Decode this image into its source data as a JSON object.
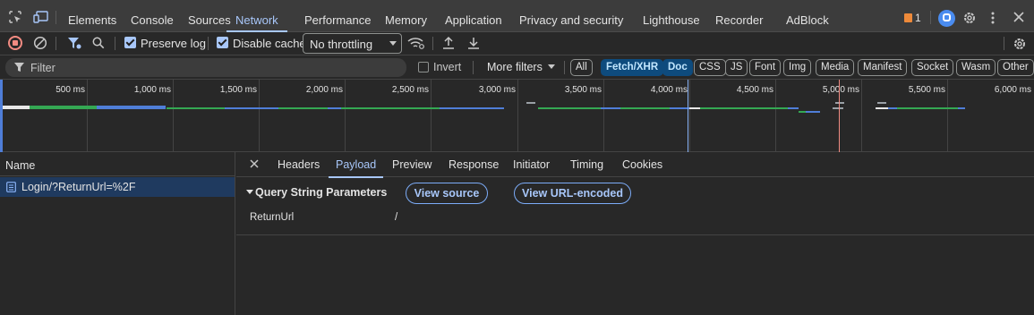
{
  "tabs": [
    {
      "label": "Elements"
    },
    {
      "label": "Console"
    },
    {
      "label": "Sources"
    },
    {
      "label": "Network"
    },
    {
      "label": "Performance"
    },
    {
      "label": "Memory"
    },
    {
      "label": "Application"
    },
    {
      "label": "Privacy and security"
    },
    {
      "label": "Lighthouse"
    },
    {
      "label": "Recorder"
    },
    {
      "label": "AdBlock"
    }
  ],
  "active_tab": "Network",
  "issues_count": "1",
  "toolbar": {
    "preserve_log": "Preserve log",
    "disable_cache": "Disable cache",
    "throttling": "No throttling"
  },
  "filter": {
    "placeholder": "Filter",
    "invert": "Invert",
    "more_filters": "More filters",
    "chips": [
      "All",
      "Fetch/XHR",
      "Doc",
      "CSS",
      "JS",
      "Font",
      "Img",
      "Media",
      "Manifest",
      "Socket",
      "Wasm",
      "Other"
    ]
  },
  "timeline": {
    "ticks": [
      "500 ms",
      "1,000 ms",
      "1,500 ms",
      "2,000 ms",
      "2,500 ms",
      "3,000 ms",
      "3,500 ms",
      "4,000 ms",
      "4,500 ms",
      "5,000 ms",
      "5,500 ms",
      "6,000 ms"
    ]
  },
  "requests": {
    "header": "Name",
    "rows": [
      {
        "name": "Login/?ReturnUrl=%2F"
      }
    ]
  },
  "detail": {
    "tabs": [
      "Headers",
      "Payload",
      "Preview",
      "Response",
      "Initiator",
      "Timing",
      "Cookies"
    ],
    "active": "Payload",
    "section": "Query String Parameters",
    "view_source": "View source",
    "view_url_encoded": "View URL-encoded",
    "params": [
      {
        "key": "ReturnUrl",
        "value": "/"
      }
    ]
  },
  "colors": {
    "accent": "#a8c7fa",
    "record": "#f28b82",
    "green": "#34a853",
    "blue": "#4f7ed8"
  }
}
